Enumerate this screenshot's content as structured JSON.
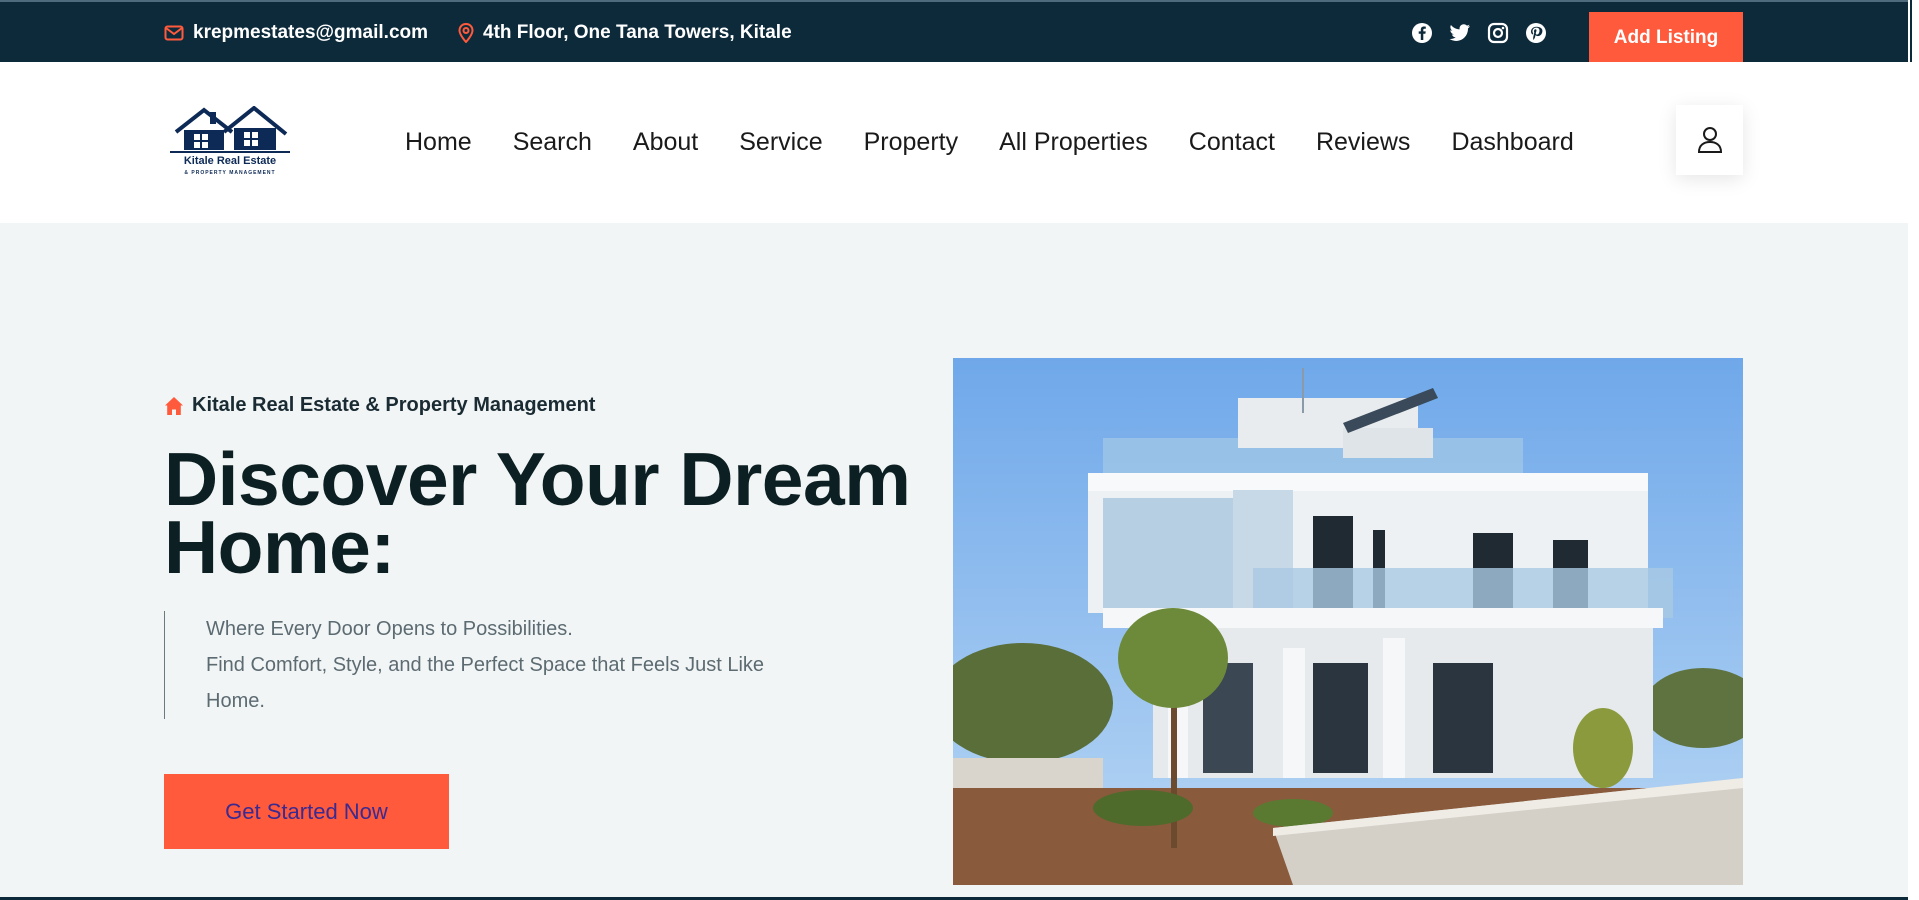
{
  "topbar": {
    "email": "krepmestates@gmail.com",
    "address": "4th Floor, One Tana Towers, Kitale",
    "social_icons": [
      "facebook-icon",
      "twitter-icon",
      "instagram-icon",
      "pinterest-icon"
    ],
    "add_listing_label": "Add Listing"
  },
  "header": {
    "logo_text": "Kitale Real Estate",
    "logo_subtext": "& PROPERTY MANAGEMENT",
    "nav": [
      "Home",
      "Search",
      "About",
      "Service",
      "Property",
      "All Properties",
      "Contact",
      "Reviews",
      "Dashboard"
    ],
    "user_icon": "user-icon"
  },
  "hero": {
    "kicker": "Kitale Real Estate & Property Management",
    "title_line1": "Discover Your Dream",
    "title_line2": "Home:",
    "description_line1": "Where Every Door Opens to Possibilities.",
    "description_line2": "Find Comfort, Style, and the Perfect Space that Feels Just Like",
    "description_line3": "Home.",
    "cta_label": "Get Started Now"
  },
  "colors": {
    "topbar_bg": "#0d2a3b",
    "accent": "#ff5a3c",
    "hero_bg": "#f2f5f5",
    "heading": "#0c1f22"
  }
}
